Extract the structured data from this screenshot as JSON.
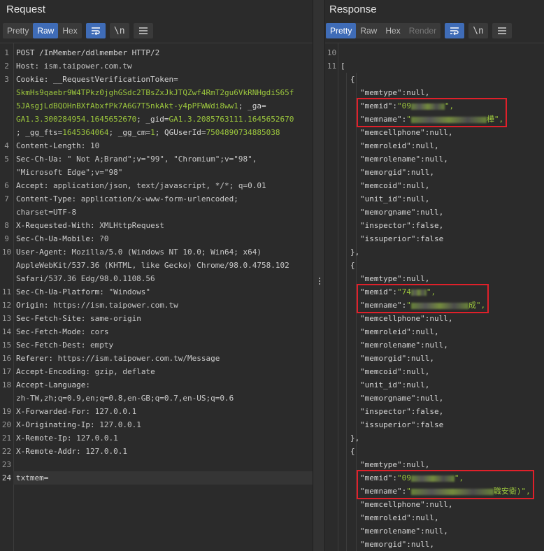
{
  "request": {
    "title": "Request",
    "tabs": [
      "Pretty",
      "Raw",
      "Hex"
    ],
    "active_tab": "Raw",
    "buttons": {
      "wrap": "wrap-icon",
      "newline": "\\n",
      "menu": "menu-icon"
    },
    "lines": [
      {
        "n": "1",
        "parts": [
          [
            "k",
            "POST /InMember/ddlmember HTTP/2"
          ]
        ]
      },
      {
        "n": "2",
        "parts": [
          [
            "k",
            "Host: "
          ],
          [
            "v",
            "ism.taipower.com.tw"
          ]
        ]
      },
      {
        "n": "3",
        "parts": [
          [
            "k",
            "Cookie: __RequestVerificationToken="
          ]
        ]
      },
      {
        "n": "",
        "parts": [
          [
            "g",
            "SkmHs9qaebr9W4TPkz0jghGSdc2TBsZxJkJTQZwf4RmT2gu6VkRNHgdiS65f"
          ]
        ]
      },
      {
        "n": "",
        "parts": [
          [
            "g",
            "5JAsgjLdBQOHnBXfAbxfPk7A6G7T5nkAkt-y4pPFWWdi8ww1"
          ],
          [
            "k",
            "; _ga="
          ]
        ]
      },
      {
        "n": "",
        "parts": [
          [
            "g",
            "GA1.3.300284954.1645652670"
          ],
          [
            "k",
            "; _gid="
          ],
          [
            "g",
            "GA1.3.2085763111.1645652670"
          ]
        ]
      },
      {
        "n": "",
        "parts": [
          [
            "k",
            "; _gg_fts="
          ],
          [
            "g",
            "1645364064"
          ],
          [
            "k",
            "; _gg_cm="
          ],
          [
            "g",
            "1"
          ],
          [
            "k",
            "; QGUserId="
          ],
          [
            "g",
            "7504890734885038"
          ]
        ]
      },
      {
        "n": "4",
        "parts": [
          [
            "k",
            "Content-Length: "
          ],
          [
            "v",
            "10"
          ]
        ]
      },
      {
        "n": "5",
        "parts": [
          [
            "k",
            "Sec-Ch-Ua: "
          ],
          [
            "v",
            "\" Not A;Brand\";v=\"99\", \"Chromium\";v=\"98\","
          ]
        ]
      },
      {
        "n": "",
        "parts": [
          [
            "v",
            "\"Microsoft Edge\";v=\"98\""
          ]
        ]
      },
      {
        "n": "6",
        "parts": [
          [
            "k",
            "Accept: "
          ],
          [
            "v",
            "application/json, text/javascript, */*; q=0.01"
          ]
        ]
      },
      {
        "n": "7",
        "parts": [
          [
            "k",
            "Content-Type: "
          ],
          [
            "v",
            "application/x-www-form-urlencoded;"
          ]
        ]
      },
      {
        "n": "",
        "parts": [
          [
            "v",
            "charset=UTF-8"
          ]
        ]
      },
      {
        "n": "8",
        "parts": [
          [
            "k",
            "X-Requested-With: "
          ],
          [
            "v",
            "XMLHttpRequest"
          ]
        ]
      },
      {
        "n": "9",
        "parts": [
          [
            "k",
            "Sec-Ch-Ua-Mobile: "
          ],
          [
            "v",
            "?0"
          ]
        ]
      },
      {
        "n": "10",
        "parts": [
          [
            "k",
            "User-Agent: "
          ],
          [
            "v",
            "Mozilla/5.0 (Windows NT 10.0; Win64; x64)"
          ]
        ]
      },
      {
        "n": "",
        "parts": [
          [
            "v",
            "AppleWebKit/537.36 (KHTML, like Gecko) Chrome/98.0.4758.102"
          ]
        ]
      },
      {
        "n": "",
        "parts": [
          [
            "v",
            "Safari/537.36 Edg/98.0.1108.56"
          ]
        ]
      },
      {
        "n": "11",
        "parts": [
          [
            "k",
            "Sec-Ch-Ua-Platform: "
          ],
          [
            "v",
            "\"Windows\""
          ]
        ]
      },
      {
        "n": "12",
        "parts": [
          [
            "k",
            "Origin: "
          ],
          [
            "v",
            "https://ism.taipower.com.tw"
          ]
        ]
      },
      {
        "n": "13",
        "parts": [
          [
            "k",
            "Sec-Fetch-Site: "
          ],
          [
            "v",
            "same-origin"
          ]
        ]
      },
      {
        "n": "14",
        "parts": [
          [
            "k",
            "Sec-Fetch-Mode: "
          ],
          [
            "v",
            "cors"
          ]
        ]
      },
      {
        "n": "15",
        "parts": [
          [
            "k",
            "Sec-Fetch-Dest: "
          ],
          [
            "v",
            "empty"
          ]
        ]
      },
      {
        "n": "16",
        "parts": [
          [
            "k",
            "Referer: "
          ],
          [
            "v",
            "https://ism.taipower.com.tw/Message"
          ]
        ]
      },
      {
        "n": "17",
        "parts": [
          [
            "k",
            "Accept-Encoding: "
          ],
          [
            "v",
            "gzip, deflate"
          ]
        ]
      },
      {
        "n": "18",
        "parts": [
          [
            "k",
            "Accept-Language: "
          ]
        ]
      },
      {
        "n": "",
        "parts": [
          [
            "v",
            "zh-TW,zh;q=0.9,en;q=0.8,en-GB;q=0.7,en-US;q=0.6"
          ]
        ]
      },
      {
        "n": "19",
        "parts": [
          [
            "k",
            "X-Forwarded-For: "
          ],
          [
            "v",
            "127.0.0.1"
          ]
        ]
      },
      {
        "n": "20",
        "parts": [
          [
            "k",
            "X-Originating-Ip: "
          ],
          [
            "v",
            "127.0.0.1"
          ]
        ]
      },
      {
        "n": "21",
        "parts": [
          [
            "k",
            "X-Remote-Ip: "
          ],
          [
            "v",
            "127.0.0.1"
          ]
        ]
      },
      {
        "n": "22",
        "parts": [
          [
            "k",
            "X-Remote-Addr: "
          ],
          [
            "v",
            "127.0.0.1"
          ]
        ]
      },
      {
        "n": "23",
        "parts": []
      },
      {
        "n": "24",
        "parts": [
          [
            "k",
            "txtmem="
          ]
        ],
        "active": true
      }
    ]
  },
  "response": {
    "title": "Response",
    "tabs": [
      "Pretty",
      "Raw",
      "Hex",
      "Render"
    ],
    "active_tab": "Pretty",
    "disabled_tabs": [
      "Render"
    ],
    "buttons": {
      "wrap": "wrap-icon",
      "newline": "\\n",
      "menu": "menu-icon"
    },
    "lines": [
      {
        "n": "10",
        "i": 0,
        "parts": []
      },
      {
        "n": "11",
        "i": 0,
        "parts": [
          [
            "jk",
            "["
          ]
        ]
      },
      {
        "n": "",
        "i": 1,
        "parts": [
          [
            "jk",
            "{"
          ]
        ]
      },
      {
        "n": "",
        "i": 2,
        "parts": [
          [
            "jk",
            "\"memtype\""
          ],
          [
            "jn",
            ":null,"
          ]
        ]
      },
      {
        "n": "",
        "i": 2,
        "parts": [
          [
            "jk",
            "\"memid\""
          ],
          [
            "jn",
            ":"
          ],
          [
            "js",
            "\"09"
          ],
          [
            "blur",
            "48"
          ],
          [
            "js",
            "\","
          ]
        ],
        "box": "a"
      },
      {
        "n": "",
        "i": 2,
        "parts": [
          [
            "jk",
            "\"memname\""
          ],
          [
            "jn",
            ":"
          ],
          [
            "js",
            "\""
          ],
          [
            "blur",
            "108"
          ],
          [
            "js",
            "樺\","
          ]
        ],
        "box": "a"
      },
      {
        "n": "",
        "i": 2,
        "parts": [
          [
            "jk",
            "\"memcellphone\""
          ],
          [
            "jn",
            ":null,"
          ]
        ]
      },
      {
        "n": "",
        "i": 2,
        "parts": [
          [
            "jk",
            "\"memroleid\""
          ],
          [
            "jn",
            ":null,"
          ]
        ]
      },
      {
        "n": "",
        "i": 2,
        "parts": [
          [
            "jk",
            "\"memrolename\""
          ],
          [
            "jn",
            ":null,"
          ]
        ]
      },
      {
        "n": "",
        "i": 2,
        "parts": [
          [
            "jk",
            "\"memorgid\""
          ],
          [
            "jn",
            ":null,"
          ]
        ]
      },
      {
        "n": "",
        "i": 2,
        "parts": [
          [
            "jk",
            "\"memcoid\""
          ],
          [
            "jn",
            ":null,"
          ]
        ]
      },
      {
        "n": "",
        "i": 2,
        "parts": [
          [
            "jk",
            "\"unit_id\""
          ],
          [
            "jn",
            ":null,"
          ]
        ]
      },
      {
        "n": "",
        "i": 2,
        "parts": [
          [
            "jk",
            "\"memorgname\""
          ],
          [
            "jn",
            ":null,"
          ]
        ]
      },
      {
        "n": "",
        "i": 2,
        "parts": [
          [
            "jk",
            "\"inspector\""
          ],
          [
            "jn",
            ":false,"
          ]
        ]
      },
      {
        "n": "",
        "i": 2,
        "parts": [
          [
            "jk",
            "\"issuperior\""
          ],
          [
            "jn",
            ":false"
          ]
        ]
      },
      {
        "n": "",
        "i": 1,
        "parts": [
          [
            "jk",
            "},"
          ]
        ]
      },
      {
        "n": "",
        "i": 1,
        "parts": [
          [
            "jk",
            "{"
          ]
        ]
      },
      {
        "n": "",
        "i": 2,
        "parts": [
          [
            "jk",
            "\"memtype\""
          ],
          [
            "jn",
            ":null,"
          ]
        ]
      },
      {
        "n": "",
        "i": 2,
        "parts": [
          [
            "jk",
            "\"memid\""
          ],
          [
            "jn",
            ":"
          ],
          [
            "js",
            "\"74"
          ],
          [
            "blur",
            "22"
          ],
          [
            "js",
            "\","
          ]
        ],
        "box": "b"
      },
      {
        "n": "",
        "i": 2,
        "parts": [
          [
            "jk",
            "\"memname\""
          ],
          [
            "jn",
            ":"
          ],
          [
            "js",
            "\""
          ],
          [
            "blur",
            "82"
          ],
          [
            "js",
            "成\","
          ]
        ],
        "box": "b"
      },
      {
        "n": "",
        "i": 2,
        "parts": [
          [
            "jk",
            "\"memcellphone\""
          ],
          [
            "jn",
            ":null,"
          ]
        ]
      },
      {
        "n": "",
        "i": 2,
        "parts": [
          [
            "jk",
            "\"memroleid\""
          ],
          [
            "jn",
            ":null,"
          ]
        ]
      },
      {
        "n": "",
        "i": 2,
        "parts": [
          [
            "jk",
            "\"memrolename\""
          ],
          [
            "jn",
            ":null,"
          ]
        ]
      },
      {
        "n": "",
        "i": 2,
        "parts": [
          [
            "jk",
            "\"memorgid\""
          ],
          [
            "jn",
            ":null,"
          ]
        ]
      },
      {
        "n": "",
        "i": 2,
        "parts": [
          [
            "jk",
            "\"memcoid\""
          ],
          [
            "jn",
            ":null,"
          ]
        ]
      },
      {
        "n": "",
        "i": 2,
        "parts": [
          [
            "jk",
            "\"unit_id\""
          ],
          [
            "jn",
            ":null,"
          ]
        ]
      },
      {
        "n": "",
        "i": 2,
        "parts": [
          [
            "jk",
            "\"memorgname\""
          ],
          [
            "jn",
            ":null,"
          ]
        ]
      },
      {
        "n": "",
        "i": 2,
        "parts": [
          [
            "jk",
            "\"inspector\""
          ],
          [
            "jn",
            ":false,"
          ]
        ]
      },
      {
        "n": "",
        "i": 2,
        "parts": [
          [
            "jk",
            "\"issuperior\""
          ],
          [
            "jn",
            ":false"
          ]
        ]
      },
      {
        "n": "",
        "i": 1,
        "parts": [
          [
            "jk",
            "},"
          ]
        ]
      },
      {
        "n": "",
        "i": 1,
        "parts": [
          [
            "jk",
            "{"
          ]
        ]
      },
      {
        "n": "",
        "i": 2,
        "parts": [
          [
            "jk",
            "\"memtype\""
          ],
          [
            "jn",
            ":null,"
          ]
        ]
      },
      {
        "n": "",
        "i": 2,
        "parts": [
          [
            "jk",
            "\"memid\""
          ],
          [
            "jn",
            ":"
          ],
          [
            "js",
            "\"09"
          ],
          [
            "blur",
            "62"
          ],
          [
            "js",
            "\","
          ]
        ],
        "box": "c"
      },
      {
        "n": "",
        "i": 2,
        "parts": [
          [
            "jk",
            "\"memname\""
          ],
          [
            "jn",
            ":"
          ],
          [
            "js",
            "\""
          ],
          [
            "blur",
            "118"
          ],
          [
            "js",
            "職安衛)\","
          ]
        ],
        "box": "c"
      },
      {
        "n": "",
        "i": 2,
        "parts": [
          [
            "jk",
            "\"memcellphone\""
          ],
          [
            "jn",
            ":null,"
          ]
        ]
      },
      {
        "n": "",
        "i": 2,
        "parts": [
          [
            "jk",
            "\"memroleid\""
          ],
          [
            "jn",
            ":null,"
          ]
        ]
      },
      {
        "n": "",
        "i": 2,
        "parts": [
          [
            "jk",
            "\"memrolename\""
          ],
          [
            "jn",
            ":null,"
          ]
        ]
      },
      {
        "n": "",
        "i": 2,
        "parts": [
          [
            "jk",
            "\"memorgid\""
          ],
          [
            "jn",
            ":null,"
          ]
        ]
      }
    ]
  },
  "colors": {
    "accent": "#3f6cb7",
    "highlight_box": "#e0202a",
    "string": "#9bc53d"
  }
}
